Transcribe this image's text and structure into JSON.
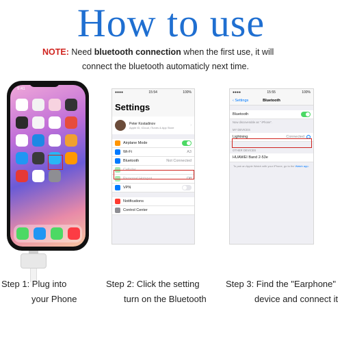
{
  "title": "How to use",
  "note": {
    "label": "NOTE:",
    "t1": " Need ",
    "bold": "bluetooth connection",
    "t2": " when the first use, it will",
    "line2": "connect the bluetooth automaticly next time."
  },
  "phone": {
    "time": "9:41"
  },
  "settings": {
    "time": "15:54",
    "battery": "100%",
    "heading": "Settings",
    "profile_name": "Peter Kostadinov",
    "profile_sub": "Apple ID, iCloud, iTunes & App Store",
    "rows": [
      {
        "label": "Airplane Mode",
        "value": ""
      },
      {
        "label": "Wi-Fi",
        "value": "A3"
      },
      {
        "label": "Bluetooth",
        "value": "Not Connected"
      },
      {
        "label": "Cellular",
        "value": ""
      },
      {
        "label": "Personal Hotspot",
        "value": "Off"
      },
      {
        "label": "VPN",
        "value": ""
      }
    ],
    "rows2": [
      {
        "label": "Notifications"
      },
      {
        "label": "Control Center"
      }
    ]
  },
  "bluetooth": {
    "time": "15:55",
    "battery": "100%",
    "back": "Settings",
    "title": "Bluetooth",
    "toggle_label": "Bluetooth",
    "discoverable": "Now discoverable as \" iPhone\".",
    "my_devices": "MY DEVICES",
    "device": "Lightning",
    "device_status": "Connected",
    "other_devices": "OTHER DEVICES",
    "other_device": "HUAWEI Band 2-53e",
    "footer": "To pair an Apple Watch with your iPhone, go to the",
    "footer_link": "Watch app."
  },
  "steps": [
    {
      "l1": "Step 1: Plug into",
      "l2": "your Phone"
    },
    {
      "l1": "Step 2: Click the setting",
      "l2": "turn on the Bluetooth"
    },
    {
      "l1": "Step 3: Find the \"Earphone\"",
      "l2": "device and connect it"
    }
  ],
  "colors": {
    "title": "#1f6fd1",
    "note_label": "#d0241f",
    "highlight": "#d0241f",
    "ios_blue": "#007aff",
    "ios_green": "#4cd964"
  }
}
